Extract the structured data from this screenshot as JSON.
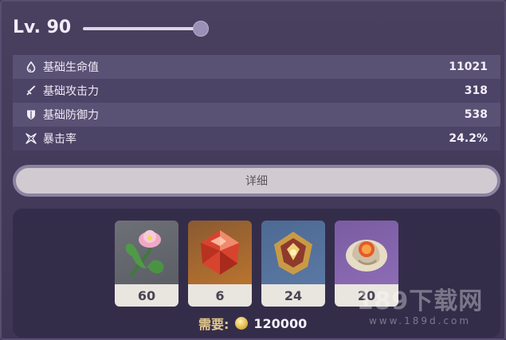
{
  "level": {
    "label": "Lv. 90",
    "progress_fraction": 1.0
  },
  "stats": [
    {
      "icon": "drop-icon",
      "label": "基础生命值",
      "value": "11021"
    },
    {
      "icon": "sword-icon",
      "label": "基础攻击力",
      "value": "318"
    },
    {
      "icon": "shield-icon",
      "label": "基础防御力",
      "value": "538"
    },
    {
      "icon": "crit-star-icon",
      "label": "暴击率",
      "value": "24.2%"
    }
  ],
  "detail_button": {
    "label": "详细"
  },
  "materials": [
    {
      "icon": "lotus-flower-icon",
      "count": "60"
    },
    {
      "icon": "red-gem-icon",
      "count": "6"
    },
    {
      "icon": "gold-emblem-icon",
      "count": "24"
    },
    {
      "icon": "ornament-scale-icon",
      "count": "20"
    }
  ],
  "cost": {
    "label": "需要:",
    "icon": "mora-coin-icon",
    "value": "120000"
  },
  "watermark": {
    "main": "189下载网",
    "sub": "www.189d.com"
  },
  "colors": {
    "panel": "#463d5c",
    "row_light": "#5a5274",
    "row_dark": "#4c4466",
    "button": "#d1cbd1",
    "cost_label": "#e4c98a"
  }
}
